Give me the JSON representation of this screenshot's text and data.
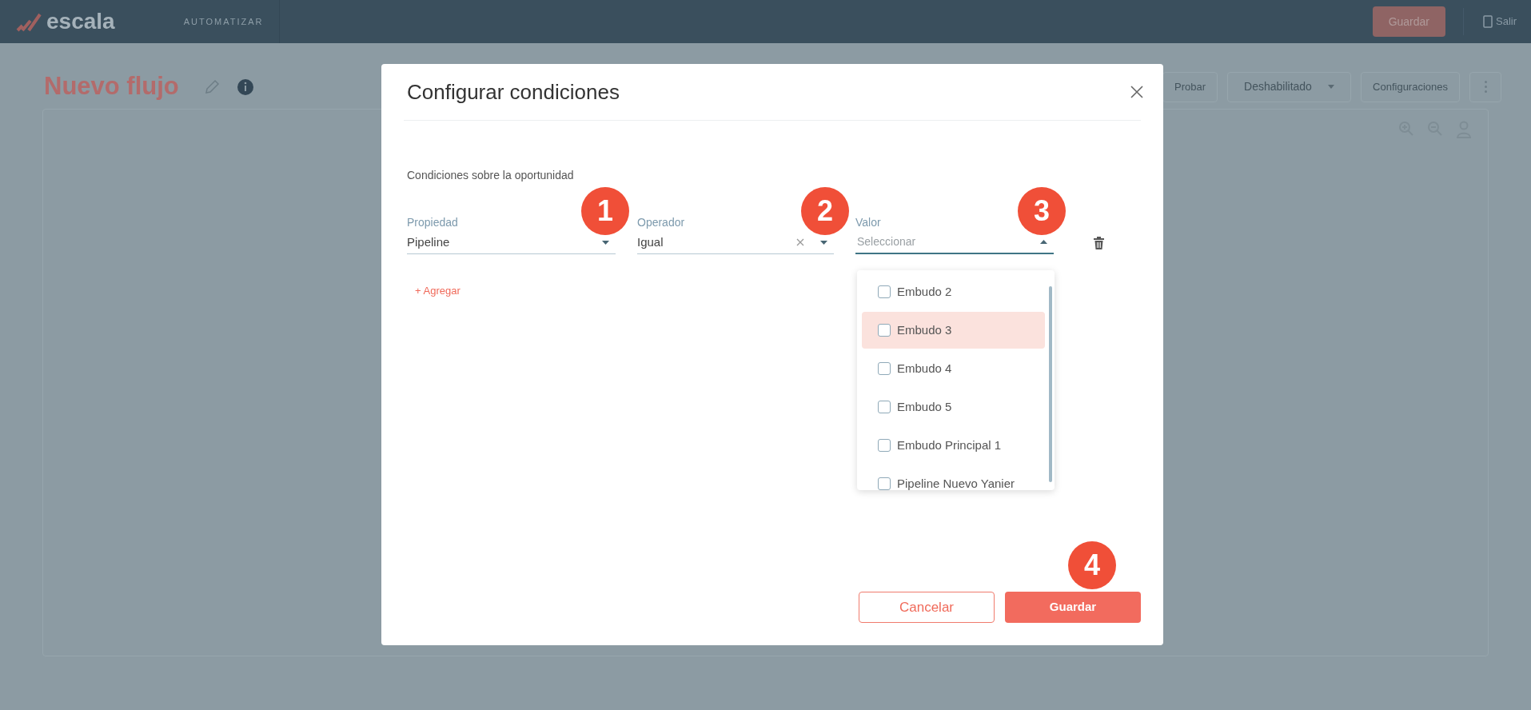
{
  "top_bar": {
    "logo": "escala",
    "section": "AUTOMATIZAR",
    "save_button": "Guardar",
    "logout": "Salir"
  },
  "header": {
    "title": "Nuevo flujo",
    "actions": [
      {
        "kind": "button",
        "label": "Probar"
      },
      {
        "kind": "dropdown",
        "label": "Deshabilitado"
      },
      {
        "kind": "button",
        "label": "Configuraciones"
      },
      {
        "kind": "menu"
      }
    ]
  },
  "modal": {
    "title": "Configurar condiciones",
    "section_label": "Condiciones sobre la oportunidad",
    "fields": [
      {
        "label": "Propiedad",
        "value": "Pipeline",
        "clearable": false,
        "open": false
      },
      {
        "label": "Operador",
        "value": "Igual",
        "clearable": true,
        "open": false
      },
      {
        "label": "Valor",
        "placeholder": "Seleccionar",
        "clearable": false,
        "open": true
      }
    ],
    "add_link": "+ Agregar",
    "options": [
      {
        "label": "Embudo 2",
        "checked": false,
        "highlighted": false
      },
      {
        "label": "Embudo 3",
        "checked": false,
        "highlighted": true
      },
      {
        "label": "Embudo 4",
        "checked": false,
        "highlighted": false
      },
      {
        "label": "Embudo 5",
        "checked": false,
        "highlighted": false
      },
      {
        "label": "Embudo Principal 1",
        "checked": false,
        "highlighted": false
      },
      {
        "label": "Pipeline Nuevo Yanier",
        "checked": false,
        "highlighted": false
      }
    ],
    "cancel_button": "Cancelar",
    "save_button": "Guardar"
  },
  "step_markers": [
    "1",
    "2",
    "3",
    "4"
  ]
}
